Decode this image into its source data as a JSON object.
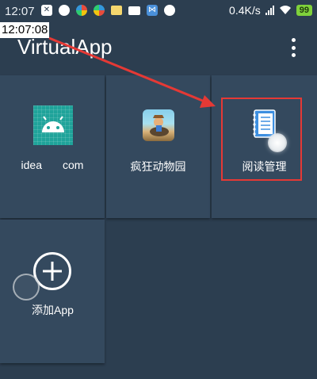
{
  "status_bar": {
    "time": "12:07",
    "net_speed": "0.4K/s",
    "battery": "99"
  },
  "overlay_clock": "12:07:08",
  "app_bar": {
    "title": "VirtualApp",
    "menu_icon": "overflow-menu-icon"
  },
  "apps": [
    {
      "label_part1": "idea",
      "label_part2": "com",
      "icon": "android-icon"
    },
    {
      "label": "疯狂动物园",
      "icon": "crazy-zoo-icon"
    },
    {
      "label": "阅读管理",
      "icon": "book-icon"
    },
    {
      "label": "添加App",
      "icon": "add-circle-icon"
    }
  ],
  "colors": {
    "background": "#2c3e50",
    "tile": "#34495e",
    "highlight": "#e53935",
    "battery": "#7fd13b"
  }
}
